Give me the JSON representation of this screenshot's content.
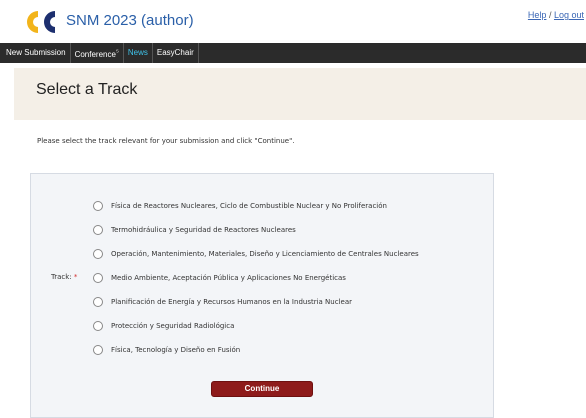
{
  "header": {
    "app_title": "SNM 2023 (author)",
    "logo_name": "easychair-logo",
    "links": {
      "help": "Help",
      "separator": "/",
      "logout": "Log out"
    }
  },
  "menubar": {
    "items": [
      {
        "label": "New Submission",
        "active": false
      },
      {
        "label": "Conference",
        "suffix": "⁵",
        "active": false
      },
      {
        "label": "News",
        "active": true
      },
      {
        "label": "EasyChair",
        "active": false
      }
    ]
  },
  "page": {
    "title": "Select a Track",
    "instructions": "Please select the track relevant for your submission and click \"Continue\"."
  },
  "form": {
    "track_label": "Track:",
    "required_marker": "*",
    "options": [
      {
        "label": "Física de Reactores Nucleares, Ciclo de Combustible Nuclear y No Proliferación",
        "selected": false
      },
      {
        "label": "Termohidráulica y Seguridad de Reactores Nucleares",
        "selected": false
      },
      {
        "label": "Operación, Mantenimiento, Materiales, Diseño y Licenciamiento de Centrales Nucleares",
        "selected": false
      },
      {
        "label": "Medio Ambiente, Aceptación Pública y Aplicaciones No Energéticas",
        "selected": false
      },
      {
        "label": "Planificación de Energía y Recursos Humanos en la Industria Nuclear",
        "selected": false
      },
      {
        "label": "Protección y Seguridad Radiológica",
        "selected": false
      },
      {
        "label": "Física, Tecnología y Diseño en Fusión",
        "selected": false
      }
    ],
    "continue_label": "Continue"
  },
  "colors": {
    "menubar_bg": "#2b2b2b",
    "active_menu": "#3ec1e8",
    "title_color": "#2a5fa8",
    "button_bg": "#8e1b1b",
    "logo_yellow": "#f2b41b",
    "logo_navy": "#1d2f6f"
  }
}
